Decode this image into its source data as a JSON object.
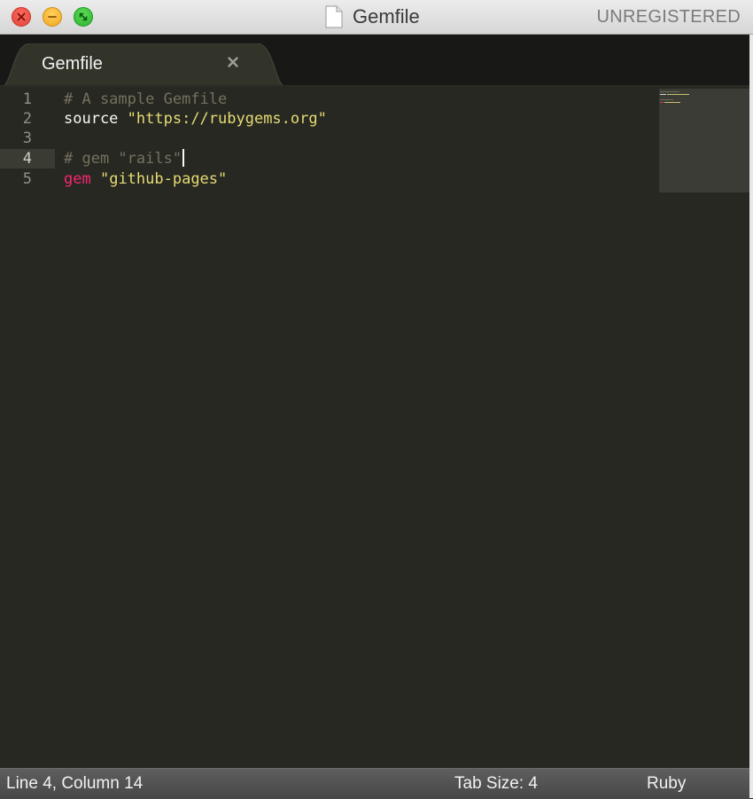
{
  "window": {
    "title": "Gemfile",
    "license_status": "UNREGISTERED"
  },
  "tabs": [
    {
      "label": "Gemfile",
      "active": true
    }
  ],
  "editor": {
    "active_line": 4,
    "lines": [
      {
        "number": "1",
        "text": "# A sample Gemfile"
      },
      {
        "number": "2",
        "text": "source \"https://rubygems.org\""
      },
      {
        "number": "3",
        "text": ""
      },
      {
        "number": "4",
        "text": "# gem \"rails\""
      },
      {
        "number": "5",
        "text": "gem \"github-pages\""
      }
    ],
    "tokens": {
      "l1_comment": "# A sample Gemfile",
      "l2_keyword": "source",
      "l2_string": "\"https://rubygems.org\"",
      "l4_comment": "# gem \"rails\"",
      "l5_keyword": "gem",
      "l5_string": "\"github-pages\""
    }
  },
  "statusbar": {
    "position": "Line 4, Column 14",
    "tab_size": "Tab Size: 4",
    "syntax": "Ruby"
  },
  "icons": {
    "close": "close-window-icon",
    "minimize": "minimize-window-icon",
    "zoom": "zoom-window-icon",
    "document": "document-icon",
    "tab_close": "close-tab-icon"
  },
  "colors": {
    "background": "#272822",
    "comment": "#75715e",
    "string": "#e6db74",
    "keyword": "#f92672",
    "text": "#f8f8f2"
  }
}
